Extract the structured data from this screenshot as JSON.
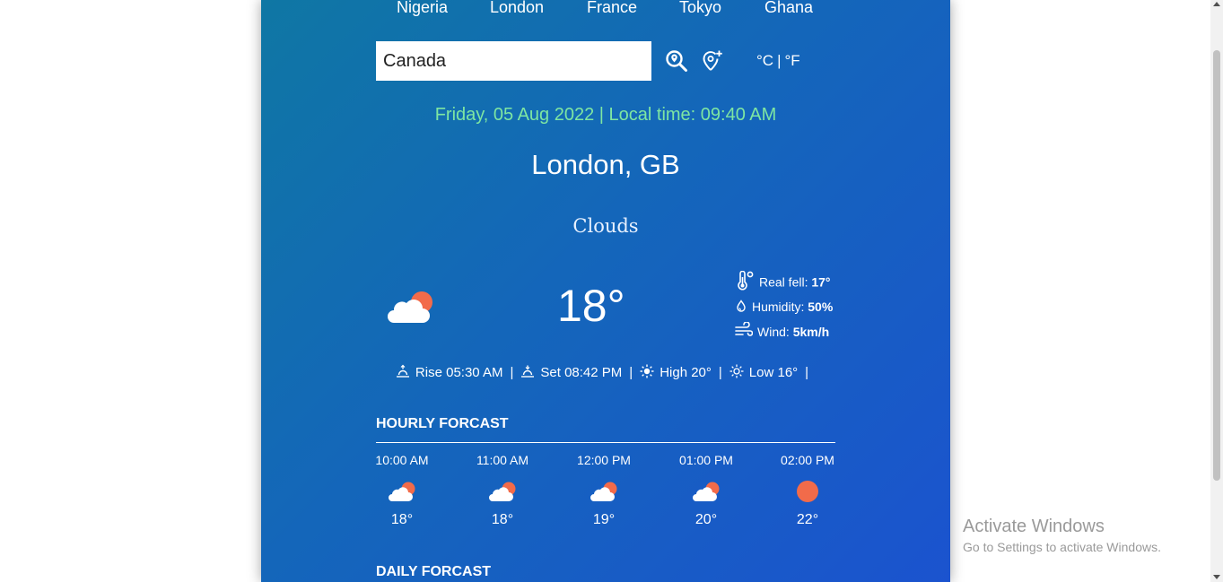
{
  "cities": [
    "Nigeria",
    "London",
    "France",
    "Tokyo",
    "Ghana"
  ],
  "search": {
    "value": "Canada"
  },
  "icons": {
    "search": "search-location-icon",
    "location": "current-location-icon"
  },
  "units": {
    "celsius": "°C",
    "separator": "|",
    "fahrenheit": "°F"
  },
  "datetime": "Friday, 05 Aug 2022 | Local time: 09:40 AM",
  "location": "London, GB",
  "condition": "Clouds",
  "current_temp": "18°",
  "details": [
    {
      "label": "Real fell:",
      "value": "17°",
      "icon": "thermometer-icon"
    },
    {
      "label": "Humidity:",
      "value": "50%",
      "icon": "droplet-icon"
    },
    {
      "label": "Wind:",
      "value": "5km/h",
      "icon": "wind-icon"
    }
  ],
  "sun": {
    "rise": "Rise 05:30 AM",
    "set": "Set 08:42 PM",
    "high": "High 20°",
    "low": "Low 16°",
    "separator": "|"
  },
  "hourly_title": "HOURLY FORCAST",
  "hourly": [
    {
      "time": "10:00 AM",
      "temp": "18°",
      "icon": "partly-cloudy-icon"
    },
    {
      "time": "11:00 AM",
      "temp": "18°",
      "icon": "partly-cloudy-icon"
    },
    {
      "time": "12:00 PM",
      "temp": "19°",
      "icon": "partly-cloudy-icon"
    },
    {
      "time": "01:00 PM",
      "temp": "20°",
      "icon": "partly-cloudy-icon"
    },
    {
      "time": "02:00 PM",
      "temp": "22°",
      "icon": "sun-icon"
    }
  ],
  "daily_title": "DAILY FORCAST",
  "watermark": {
    "title": "Activate Windows",
    "subtitle": "Go to Settings to activate Windows."
  },
  "colors": {
    "accent_datetime": "#7ee6a2",
    "sun": "#f26b4a",
    "cloud": "#ffffff"
  }
}
